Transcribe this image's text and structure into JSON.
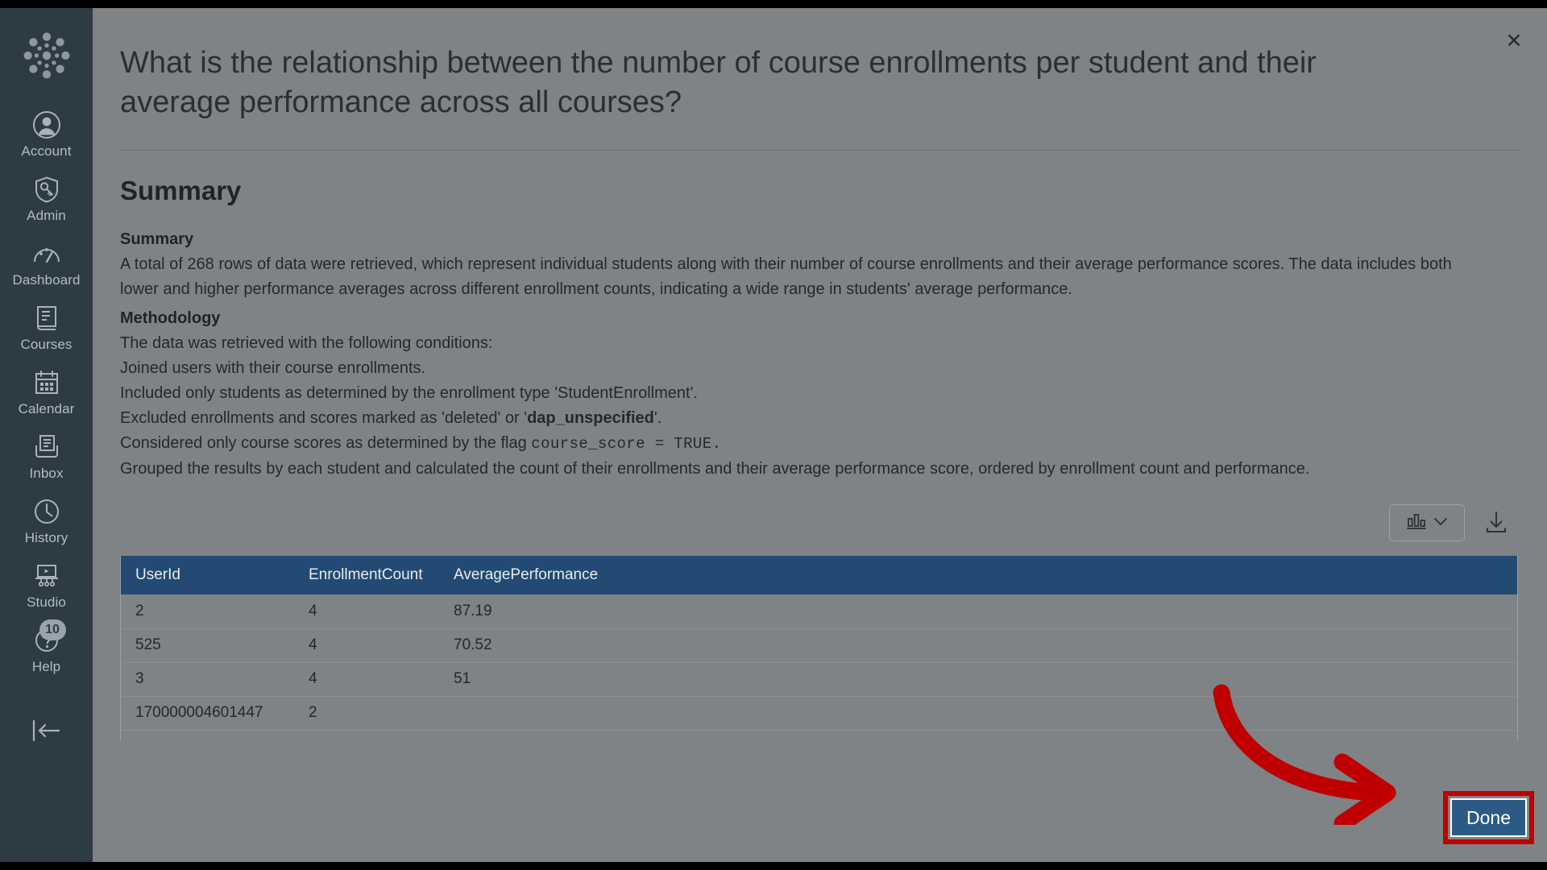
{
  "sidebar": {
    "brand_icon": "canvas-logo-icon",
    "items": [
      {
        "icon": "account-avatar-icon",
        "label": "Account",
        "badge": null
      },
      {
        "icon": "shield-key-admin-icon",
        "label": "Admin",
        "badge": null
      },
      {
        "icon": "dashboard-gauge-icon",
        "label": "Dashboard",
        "badge": null
      },
      {
        "icon": "courses-book-icon",
        "label": "Courses",
        "badge": null
      },
      {
        "icon": "calendar-icon",
        "label": "Calendar",
        "badge": null
      },
      {
        "icon": "inbox-icon",
        "label": "Inbox",
        "badge": null
      },
      {
        "icon": "history-clock-icon",
        "label": "History",
        "badge": null
      },
      {
        "icon": "studio-video-icon",
        "label": "Studio",
        "badge": null
      },
      {
        "icon": "help-question-icon",
        "label": "Help",
        "badge": "10"
      }
    ],
    "collapse_icon": "collapse-left-arrow-icon"
  },
  "panel": {
    "close_icon": "close-icon",
    "title": "What is the relationship between the number of course enrollments per student and their average performance across all courses?",
    "section_title": "Summary",
    "summary_heading": "Summary",
    "summary_body": "A total of 268 rows of data were retrieved, which represent individual students along with their number of course enrollments and their average performance scores. The data includes both lower and higher performance averages across different enrollment counts, indicating a wide range in students' average performance.",
    "methodology_heading": "Methodology",
    "methodology_intro": "The data was retrieved with the following conditions:",
    "methodology_line_1": "Joined users with their course enrollments.",
    "methodology_line_2": "Included only students as determined by the enrollment type 'StudentEnrollment'.",
    "methodology_line_3_pre": "Excluded enrollments and scores marked as 'deleted' or '",
    "methodology_line_3_bold": "dap_unspecified",
    "methodology_line_3_post": "'.",
    "methodology_line_4_pre": "Considered only course scores as determined by the flag ",
    "methodology_line_4_code": "course_score",
    "methodology_line_4_post": " =  TRUE.",
    "methodology_line_5": "Grouped the results by each student and calculated the count of their enrollments and their average performance score, ordered by enrollment count and performance."
  },
  "toolbar": {
    "viz_icon": "bar-chart-icon",
    "viz_chevron_icon": "chevron-down-icon",
    "download_icon": "download-icon"
  },
  "table": {
    "columns": [
      "UserId",
      "EnrollmentCount",
      "AveragePerformance"
    ],
    "rows": [
      [
        "2",
        "4",
        "87.19"
      ],
      [
        "525",
        "4",
        "70.52"
      ],
      [
        "3",
        "4",
        "51"
      ],
      [
        "170000004601447",
        "2",
        ""
      ]
    ]
  },
  "footer": {
    "done_label": "Done"
  },
  "annotation": {
    "arrow_color": "#C00000",
    "highlight_color": "#C00000"
  },
  "colors": {
    "sidebar_bg": "#2D3B45",
    "panel_bg": "#7F8385",
    "table_header_bg": "#234A73",
    "primary_button_bg": "#2B5B85"
  }
}
